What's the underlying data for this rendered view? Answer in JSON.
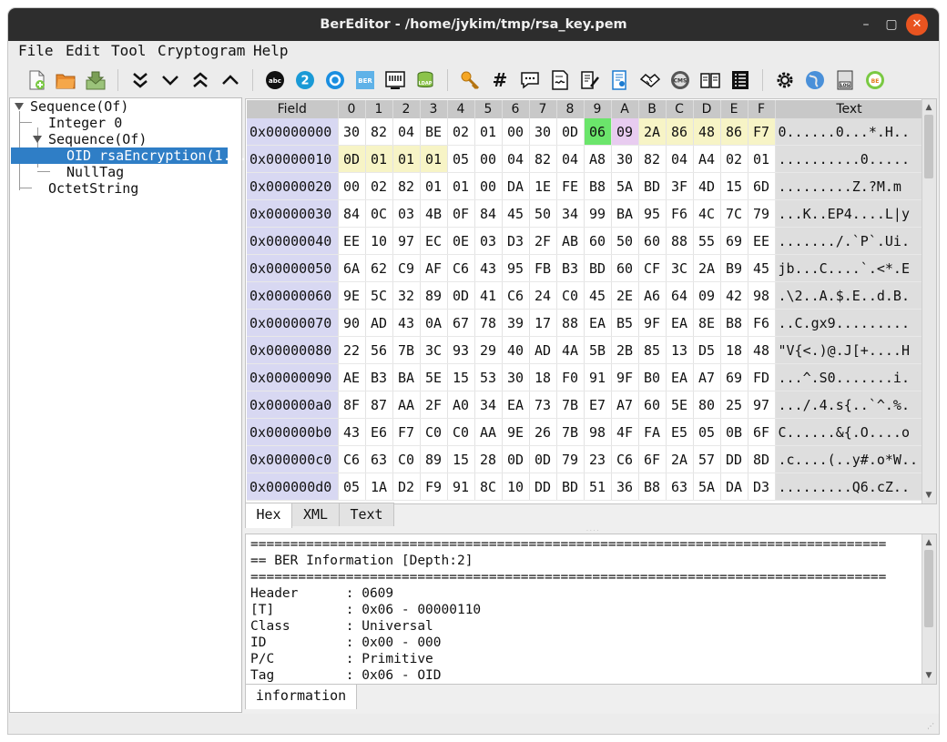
{
  "window": {
    "title": "BerEditor - /home/jykim/tmp/rsa_key.pem",
    "min": "–",
    "max": "▢",
    "close": "✕"
  },
  "menu": [
    {
      "label": "File",
      "name": "menu-file"
    },
    {
      "label": "Edit",
      "name": "menu-edit"
    },
    {
      "label": "Tool",
      "name": "menu-tool"
    },
    {
      "label": "Cryptogram",
      "name": "menu-cryptogram"
    },
    {
      "label": "Help",
      "name": "menu-help"
    }
  ],
  "toolbar_icons": [
    "new-file-icon",
    "open-folder-icon",
    "save-icon",
    "expand-all-icon",
    "expand-icon",
    "collapse-all-icon",
    "collapse-icon",
    "decode-text-icon",
    "base64-icon",
    "oid-icon",
    "ber-icon",
    "data-encode-icon",
    "ldap-icon",
    "key-icon",
    "hash-icon",
    "message-icon",
    "sign-icon",
    "verify-icon",
    "certificate-icon",
    "key-agreement-icon",
    "cms-icon",
    "ssh-icon",
    "list-icon",
    "settings-icon",
    "web-icon",
    "print-log-icon",
    "ber-check-icon"
  ],
  "tree": [
    {
      "label": "Sequence(Of)",
      "depth": 0,
      "expanded": true
    },
    {
      "label": "Integer 0",
      "depth": 1,
      "expanded": false
    },
    {
      "label": "Sequence(Of)",
      "depth": 1,
      "expanded": true
    },
    {
      "label": "OID rsaEncryption(1...",
      "depth": 2,
      "expanded": false,
      "selected": true
    },
    {
      "label": "NullTag",
      "depth": 2,
      "expanded": false
    },
    {
      "label": "OctetString",
      "depth": 1,
      "expanded": false
    }
  ],
  "hex": {
    "columns": [
      "Field",
      "0",
      "1",
      "2",
      "3",
      "4",
      "5",
      "6",
      "7",
      "8",
      "9",
      "A",
      "B",
      "C",
      "D",
      "E",
      "F",
      "Text"
    ],
    "rows": [
      {
        "addr": "0x00000000",
        "bytes": [
          "30",
          "82",
          "04",
          "BE",
          "02",
          "01",
          "00",
          "30",
          "0D",
          "06",
          "09",
          "2A",
          "86",
          "48",
          "86",
          "F7"
        ],
        "text": "0......0...*.H.."
      },
      {
        "addr": "0x00000010",
        "bytes": [
          "0D",
          "01",
          "01",
          "01",
          "05",
          "00",
          "04",
          "82",
          "04",
          "A8",
          "30",
          "82",
          "04",
          "A4",
          "02",
          "01"
        ],
        "text": "..........0....."
      },
      {
        "addr": "0x00000020",
        "bytes": [
          "00",
          "02",
          "82",
          "01",
          "01",
          "00",
          "DA",
          "1E",
          "FE",
          "B8",
          "5A",
          "BD",
          "3F",
          "4D",
          "15",
          "6D"
        ],
        "text": ".........Z.?M.m"
      },
      {
        "addr": "0x00000030",
        "bytes": [
          "84",
          "0C",
          "03",
          "4B",
          "0F",
          "84",
          "45",
          "50",
          "34",
          "99",
          "BA",
          "95",
          "F6",
          "4C",
          "7C",
          "79"
        ],
        "text": "...K..EP4....L|y"
      },
      {
        "addr": "0x00000040",
        "bytes": [
          "EE",
          "10",
          "97",
          "EC",
          "0E",
          "03",
          "D3",
          "2F",
          "AB",
          "60",
          "50",
          "60",
          "88",
          "55",
          "69",
          "EE"
        ],
        "text": "......./.`P`.Ui."
      },
      {
        "addr": "0x00000050",
        "bytes": [
          "6A",
          "62",
          "C9",
          "AF",
          "C6",
          "43",
          "95",
          "FB",
          "B3",
          "BD",
          "60",
          "CF",
          "3C",
          "2A",
          "B9",
          "45"
        ],
        "text": "jb...C....`.<*.E"
      },
      {
        "addr": "0x00000060",
        "bytes": [
          "9E",
          "5C",
          "32",
          "89",
          "0D",
          "41",
          "C6",
          "24",
          "C0",
          "45",
          "2E",
          "A6",
          "64",
          "09",
          "42",
          "98"
        ],
        "text": ".\\2..A.$.E..d.B."
      },
      {
        "addr": "0x00000070",
        "bytes": [
          "90",
          "AD",
          "43",
          "0A",
          "67",
          "78",
          "39",
          "17",
          "88",
          "EA",
          "B5",
          "9F",
          "EA",
          "8E",
          "B8",
          "F6"
        ],
        "text": "..C.gx9........."
      },
      {
        "addr": "0x00000080",
        "bytes": [
          "22",
          "56",
          "7B",
          "3C",
          "93",
          "29",
          "40",
          "AD",
          "4A",
          "5B",
          "2B",
          "85",
          "13",
          "D5",
          "18",
          "48"
        ],
        "text": "\"V{<.)@.J[+....H"
      },
      {
        "addr": "0x00000090",
        "bytes": [
          "AE",
          "B3",
          "BA",
          "5E",
          "15",
          "53",
          "30",
          "18",
          "F0",
          "91",
          "9F",
          "B0",
          "EA",
          "A7",
          "69",
          "FD"
        ],
        "text": "...^.S0.......i."
      },
      {
        "addr": "0x000000a0",
        "bytes": [
          "8F",
          "87",
          "AA",
          "2F",
          "A0",
          "34",
          "EA",
          "73",
          "7B",
          "E7",
          "A7",
          "60",
          "5E",
          "80",
          "25",
          "97"
        ],
        "text": ".../.4.s{..`^.%."
      },
      {
        "addr": "0x000000b0",
        "bytes": [
          "43",
          "E6",
          "F7",
          "C0",
          "C0",
          "AA",
          "9E",
          "26",
          "7B",
          "98",
          "4F",
          "FA",
          "E5",
          "05",
          "0B",
          "6F"
        ],
        "text": "C......&{.O....o"
      },
      {
        "addr": "0x000000c0",
        "bytes": [
          "C6",
          "63",
          "C0",
          "89",
          "15",
          "28",
          "0D",
          "0D",
          "79",
          "23",
          "C6",
          "6F",
          "2A",
          "57",
          "DD",
          "8D"
        ],
        "text": ".c....(..y#.o*W.."
      },
      {
        "addr": "0x000000d0",
        "bytes": [
          "05",
          "1A",
          "D2",
          "F9",
          "91",
          "8C",
          "10",
          "DD",
          "BD",
          "51",
          "36",
          "B8",
          "63",
          "5A",
          "DA",
          "D3"
        ],
        "text": ".........Q6.cZ.."
      }
    ],
    "highlight_colors": {
      "tag": "#6be56b",
      "length": "#e8ccf0",
      "value": "#f7f4c6"
    }
  },
  "view_tabs": [
    {
      "label": "Hex",
      "active": true
    },
    {
      "label": "XML",
      "active": false
    },
    {
      "label": "Text",
      "active": false
    }
  ],
  "info": {
    "lines": [
      "================================================================================",
      "== BER Information [Depth:2]",
      "================================================================================",
      "Header      : 0609",
      "[T]         : 0x06 - 00000110",
      "Class       : Universal",
      "ID          : 0x00 - 000",
      "P/C         : Primitive",
      "Tag         : 0x06 - OID"
    ]
  },
  "info_tabs": [
    {
      "label": "information",
      "active": true
    }
  ]
}
